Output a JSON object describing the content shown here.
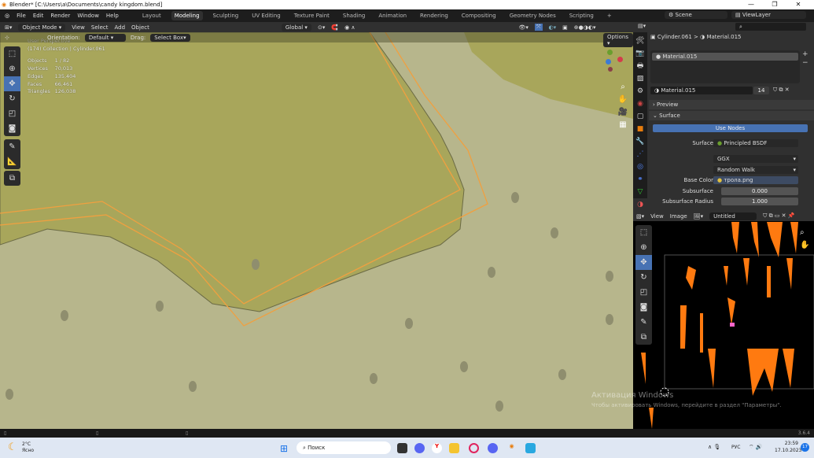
{
  "window": {
    "title": "Blender* [C:\\Users\\a\\Documents\\candy kingdom.blend]",
    "minimize": "—",
    "maximize": "❐",
    "close": "✕"
  },
  "menu": {
    "items": [
      "File",
      "Edit",
      "Render",
      "Window",
      "Help"
    ],
    "workspaces": [
      "Layout",
      "Modeling",
      "Sculpting",
      "UV Editing",
      "Texture Paint",
      "Shading",
      "Animation",
      "Rendering",
      "Compositing",
      "Geometry Nodes",
      "Scripting",
      "+"
    ],
    "active_workspace": "Modeling"
  },
  "scene": {
    "scene": "Scene",
    "view_layer": "ViewLayer"
  },
  "header": {
    "mode": "Object Mode",
    "menus": [
      "View",
      "Select",
      "Add",
      "Object"
    ],
    "transform": "Global",
    "options": "Options"
  },
  "toolsettings": {
    "orientation_label": "Orientation:",
    "orientation": "Default",
    "drag_label": "Drag:",
    "drag": "Select Box"
  },
  "viewport": {
    "view": "User Perspective",
    "collection": "(174) Collection | Cylinder.061",
    "stats": [
      {
        "k": "Objects",
        "v": "1 / 82"
      },
      {
        "k": "Vertices",
        "v": "70,013"
      },
      {
        "k": "Edges",
        "v": "135,404"
      },
      {
        "k": "Faces",
        "v": "66,461"
      },
      {
        "k": "Triangles",
        "v": "126,038"
      }
    ],
    "colors": {
      "grass": "#a8a65b",
      "ground": "#b7b68c",
      "outline": "#f0a040"
    }
  },
  "properties": {
    "object": "Cylinder.061",
    "material": "Material.015",
    "slot": "Material.015",
    "users": "14",
    "preview": "Preview",
    "surface_panel": "Surface",
    "use_nodes": "Use Nodes",
    "surface_label": "Surface",
    "surface": "Principled BSDF",
    "distribution": "GGX",
    "subsurface_method": "Random Walk",
    "base_color_label": "Base Color",
    "base_color": "трола.png",
    "subsurface_label": "Subsurface",
    "subsurface": "0.000",
    "subsurface_radius_label": "Subsurface Radius",
    "subsurface_radius": "1.000"
  },
  "image_editor": {
    "menus": [
      "View",
      "Image"
    ],
    "image": "Untitled"
  },
  "watermark": {
    "line1": "Активация Windows",
    "line2": "Чтобы активировать Windows, перейдите в раздел \"Параметры\"."
  },
  "statusbar": {
    "version": "3.6.4"
  },
  "taskbar": {
    "temp": "2°C",
    "weather": "Ясно",
    "search": "Поиск",
    "lang": "РУС",
    "time": "23:59",
    "date": "17.10.2023",
    "badge": "17"
  }
}
